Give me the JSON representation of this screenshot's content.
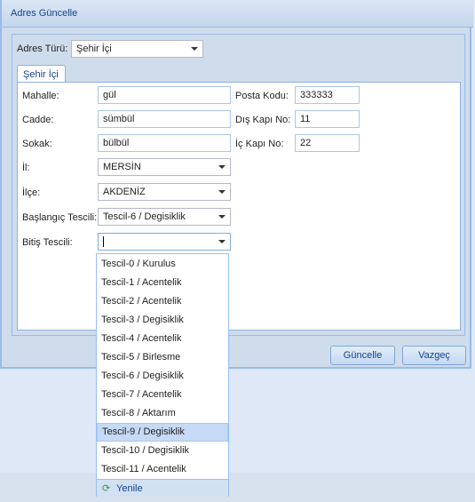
{
  "window": {
    "title": "Adres Güncelle"
  },
  "address_type": {
    "label": "Adres Türü:",
    "value": "Şehir İçi"
  },
  "tab": {
    "label": "Şehir İçi"
  },
  "form": {
    "mahalle": {
      "label": "Mahalle:",
      "value": "gül"
    },
    "cadde": {
      "label": "Cadde:",
      "value": "sümbül"
    },
    "sokak": {
      "label": "Sokak:",
      "value": "bülbül"
    },
    "il": {
      "label": "İl:",
      "value": "MERSİN"
    },
    "ilce": {
      "label": "İlçe:",
      "value": "AKDENİZ"
    },
    "baslangic": {
      "label": "Başlangıç Tescili:",
      "value": "Tescil-6 / Degisiklik"
    },
    "bitis": {
      "label": "Bitiş Tescili:",
      "value": ""
    },
    "posta_kodu": {
      "label": "Posta Kodu:",
      "value": "333333"
    },
    "dis_kapi": {
      "label": "Dış Kapı No:",
      "value": "11"
    },
    "ic_kapi": {
      "label": "İç Kapı No:",
      "value": "22"
    }
  },
  "dropdown": {
    "items": [
      "Tescil-0 / Kurulus",
      "Tescil-1 / Acentelik",
      "Tescil-2 / Acentelik",
      "Tescil-3 / Degisiklik",
      "Tescil-4 / Acentelik",
      "Tescil-5 / Birlesme",
      "Tescil-6 / Degisiklik",
      "Tescil-7 / Acentelik",
      "Tescil-8 / Aktarım",
      "Tescil-9 / Degisiklik",
      "Tescil-10 / Degisiklik",
      "Tescil-11 / Acentelik"
    ],
    "highlighted": "Tescil-9 / Degisiklik",
    "refresh_label": "Yenile"
  },
  "buttons": {
    "update": "Güncelle",
    "cancel": "Vazgeç"
  }
}
